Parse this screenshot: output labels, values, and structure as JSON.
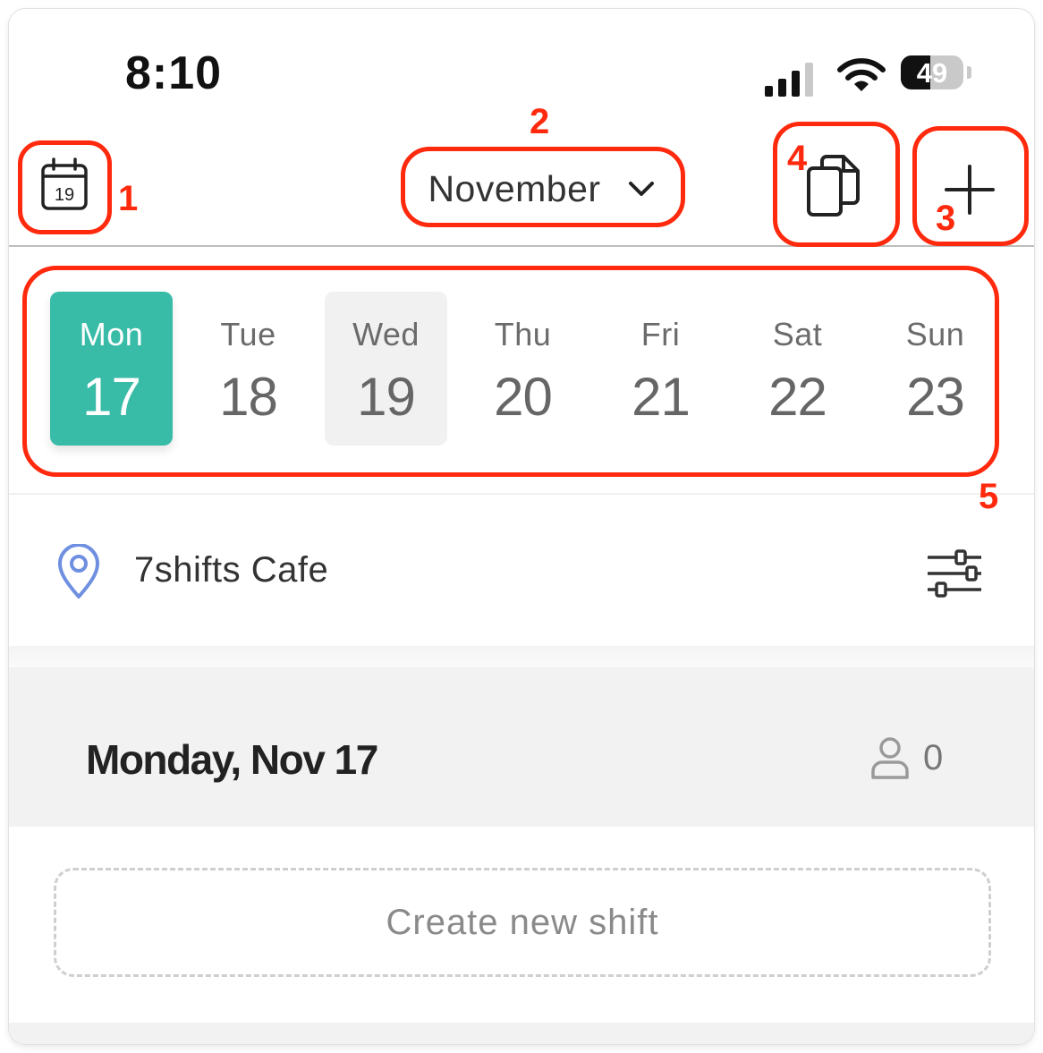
{
  "status_bar": {
    "time": "8:10",
    "battery": "49"
  },
  "header": {
    "calendar_icon": "calendar-icon",
    "calendar_day": "19",
    "month": "November",
    "copy_icon": "copy-icon",
    "add_icon": "plus-icon"
  },
  "week": {
    "days": [
      {
        "name": "Mon",
        "num": "17"
      },
      {
        "name": "Tue",
        "num": "18"
      },
      {
        "name": "Wed",
        "num": "19"
      },
      {
        "name": "Thu",
        "num": "20"
      },
      {
        "name": "Fri",
        "num": "21"
      },
      {
        "name": "Sat",
        "num": "22"
      },
      {
        "name": "Sun",
        "num": "23"
      }
    ],
    "selected": "Mon",
    "today": "Wed"
  },
  "location": {
    "name": "7shifts Cafe"
  },
  "day_section": {
    "title": "Monday, Nov 17",
    "count": "0"
  },
  "create_shift": {
    "label": "Create new shift"
  },
  "annotations": [
    "1",
    "2",
    "3",
    "4",
    "5"
  ],
  "colors": {
    "accent": "#38bba7",
    "annotation": "#ff2a0d",
    "pin": "#6f8fe0"
  }
}
